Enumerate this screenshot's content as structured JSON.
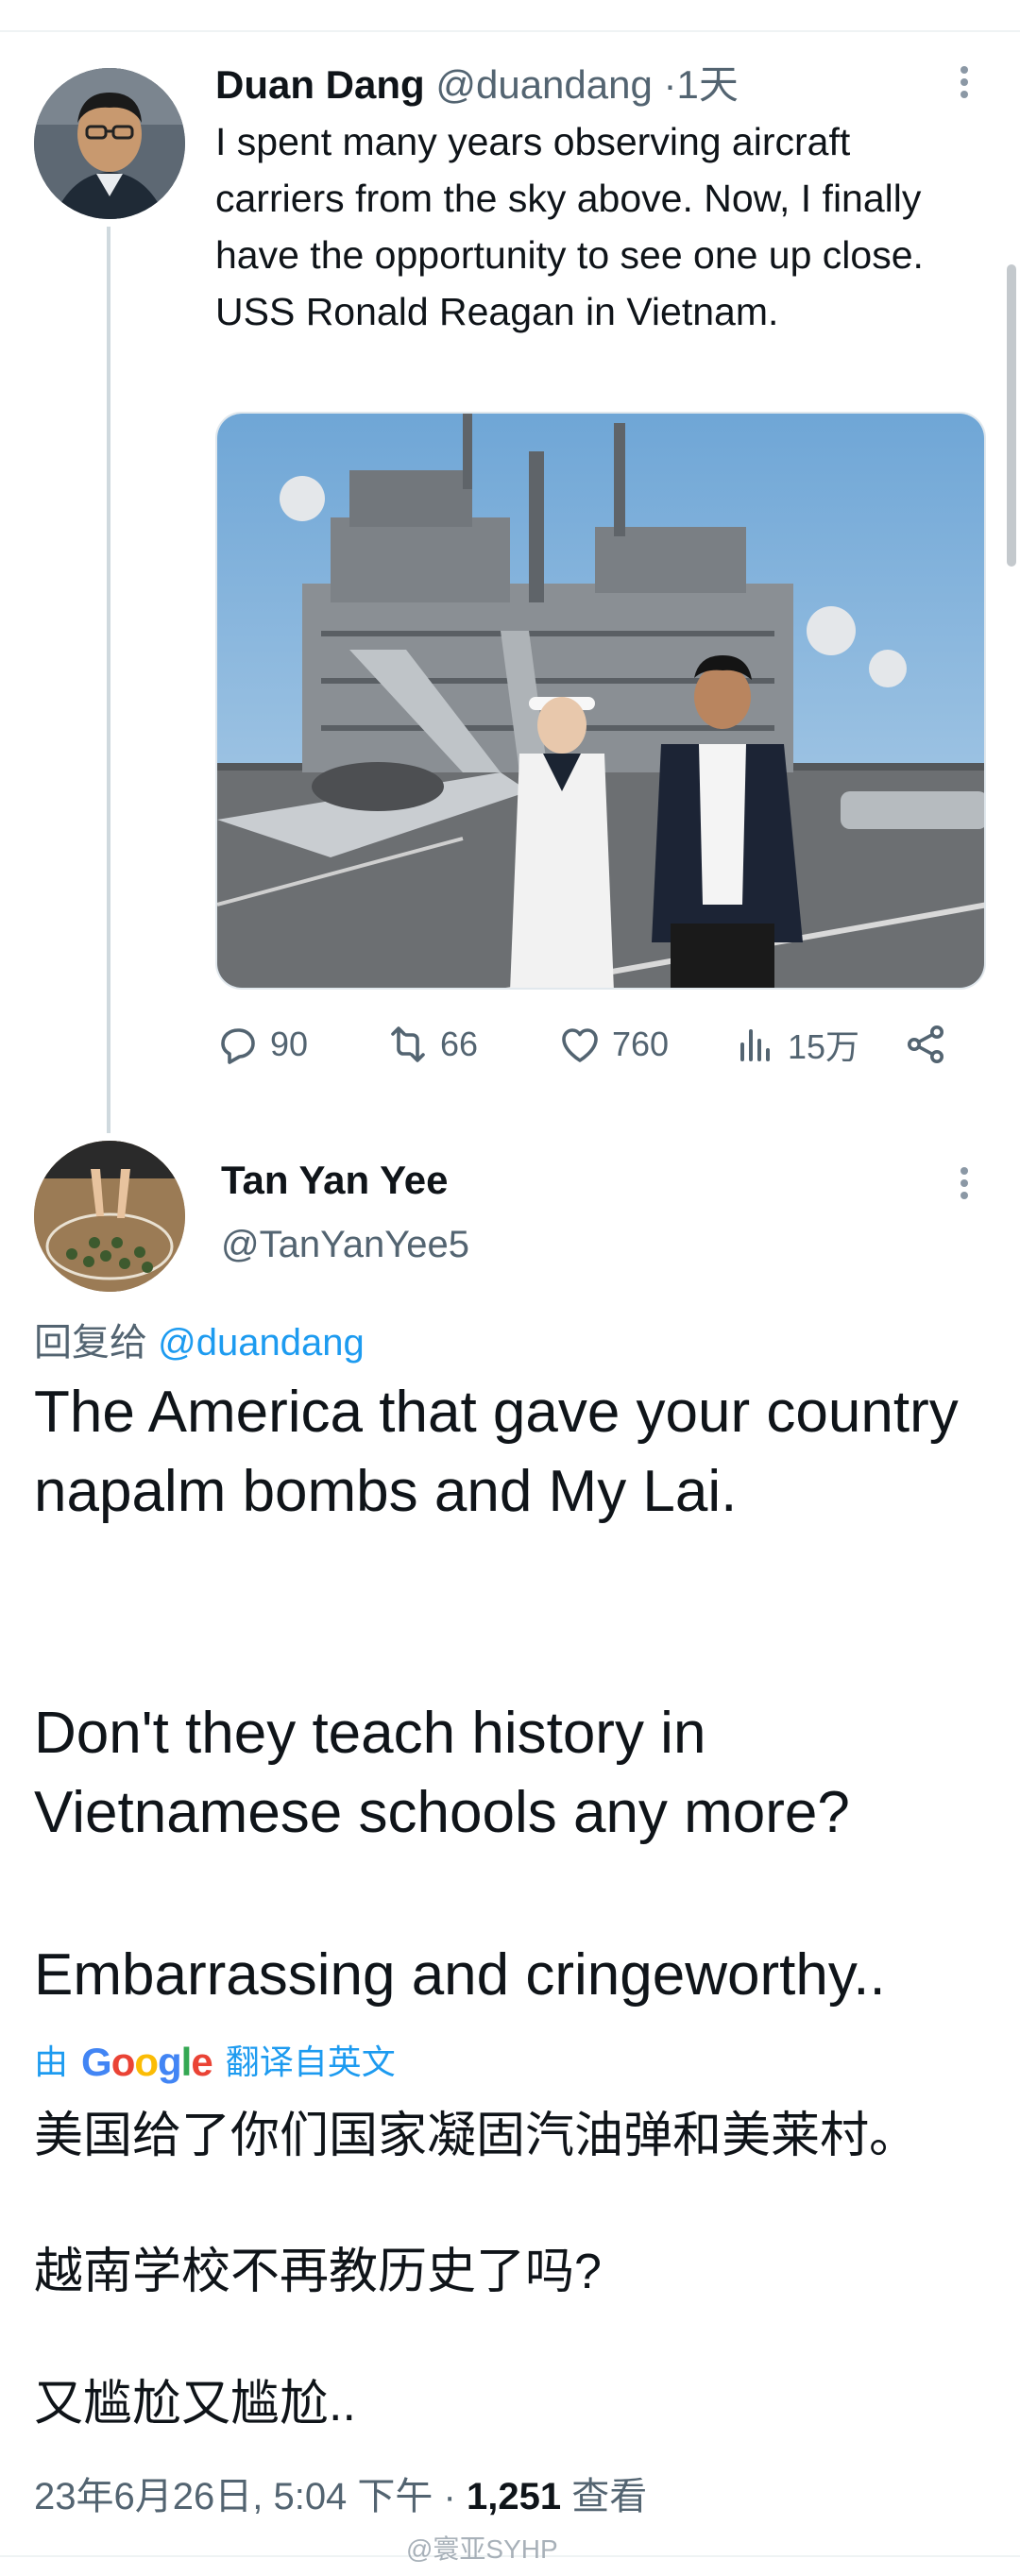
{
  "tweet": {
    "author_name": "Duan Dang",
    "author_handle": "@duandang",
    "separator": "·",
    "time_ago": "1天",
    "text": "I spent many years observing aircraft carriers from the sky above. Now, I finally have the opportunity to see one up close. USS Ronald Reagan in Vietnam.",
    "media_icon": "photo-aircraft-carrier",
    "stats": {
      "replies": "90",
      "retweets": "66",
      "likes": "760",
      "views": "15万"
    }
  },
  "reply": {
    "author_name": "Tan Yan Yee",
    "author_handle": "@TanYanYee5",
    "reply_prefix": "回复给",
    "reply_to": "@duandang",
    "text_p1": "The America that gave your country napalm bombs and My Lai.",
    "text_p2": "Don't they teach history in Vietnamese schools any more?",
    "text_p3": "Embarrassing and cringeworthy..",
    "translate_by": "由",
    "translate_brand": "Google",
    "translate_label": "翻译自英文",
    "translated_p1": "美国给了你们国家凝固汽油弹和美莱村。",
    "translated_p2": "越南学校不再教历史了吗?",
    "translated_p3": "又尴尬又尴尬..",
    "timestamp": "23年6月26日, 5:04 下午",
    "meta_separator": "·",
    "view_count": "1,251",
    "view_label": "查看"
  },
  "watermark": "@寰亚SYHP",
  "colors": {
    "accent": "#1d9bf0",
    "muted": "#536471",
    "text": "#0f1419"
  }
}
